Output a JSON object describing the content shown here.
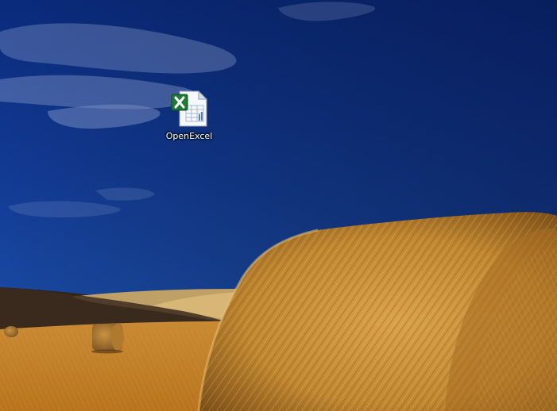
{
  "desktop": {
    "wallpaper": {
      "subject": "hay-bale-field",
      "sky_color": "#0d2f86",
      "sky_dark_color": "#041a5a",
      "field_color": "#c98a2c",
      "hill_color": "#3a2a1c"
    },
    "icons": [
      {
        "label": "OpenExcel",
        "icon": "excel-file-icon",
        "accent_color": "#1e7b34"
      }
    ]
  }
}
